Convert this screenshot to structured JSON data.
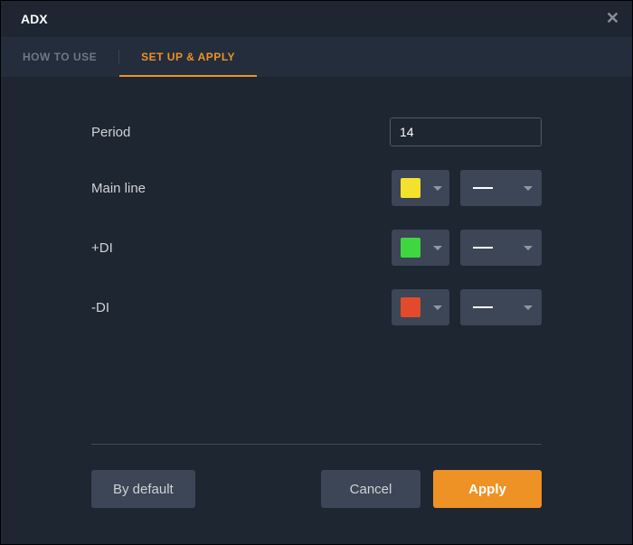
{
  "header": {
    "title": "ADX"
  },
  "tabs": {
    "how_to_use": "HOW TO USE",
    "setup_apply": "SET UP & APPLY"
  },
  "fields": {
    "period": {
      "label": "Period",
      "value": "14"
    },
    "main_line": {
      "label": "Main line",
      "color": "#f2e22e"
    },
    "plus_di": {
      "label": "+DI",
      "color": "#3fd73f"
    },
    "minus_di": {
      "label": "-DI",
      "color": "#e24a2b"
    }
  },
  "footer": {
    "by_default": "By default",
    "cancel": "Cancel",
    "apply": "Apply"
  }
}
